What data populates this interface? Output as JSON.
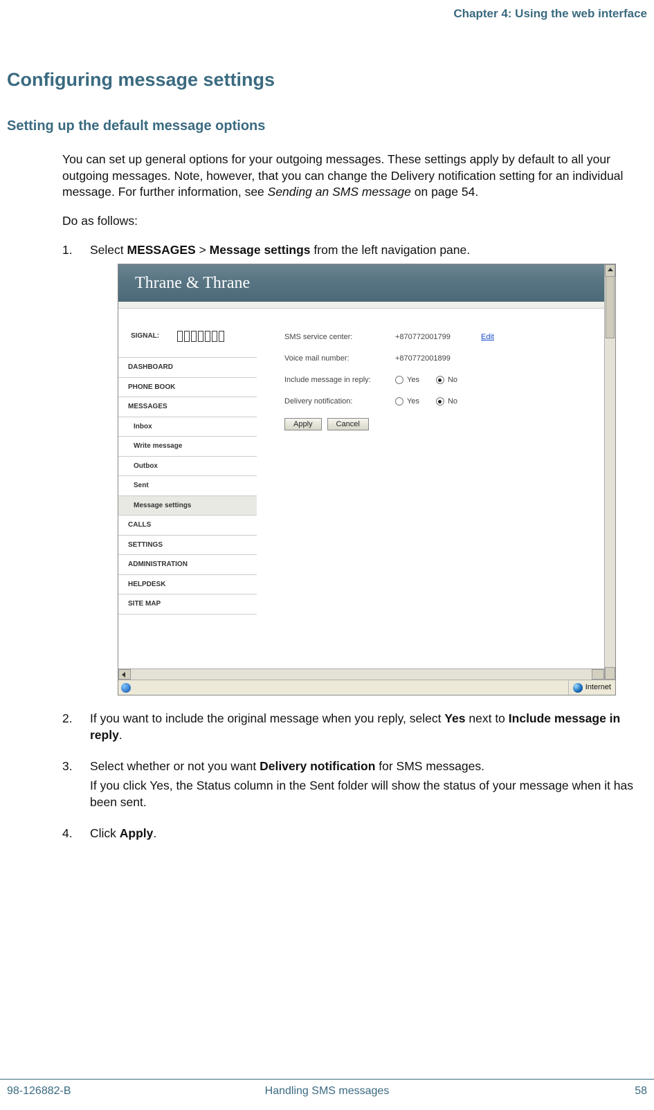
{
  "header": {
    "chapter": "Chapter 4: Using the web interface"
  },
  "h1": "Configuring message settings",
  "h2": "Setting up the default message options",
  "para1_a": "You can set up general options for your outgoing messages. These settings apply by default to all your outgoing messages. Note, however, that you can change the Delivery notification setting for an individual message. For further information, see ",
  "para1_ref": "Sending an SMS message",
  "para1_b": " on page 54.",
  "para2": "Do as follows:",
  "steps": {
    "s1_a": "Select ",
    "s1_b1": "MESSAGES",
    "s1_mid": " > ",
    "s1_b2": "Message settings",
    "s1_c": " from the left navigation pane.",
    "s2_a": "If you want to include the original message when you reply, select ",
    "s2_b1": "Yes",
    "s2_mid": " next to ",
    "s2_b2": "Include message in reply",
    "s2_c": ".",
    "s3_a": "Select whether or not you want ",
    "s3_b1": "Delivery notification",
    "s3_c": " for SMS messages.",
    "s3_sub": "If you click Yes, the Status column in the Sent folder will show the status of your message when it has been sent.",
    "s4_a": "Click ",
    "s4_b1": "Apply",
    "s4_c": "."
  },
  "shot": {
    "banner": "Thrane & Thrane",
    "signal_label": "SIGNAL:",
    "nav": {
      "dashboard": "DASHBOARD",
      "phonebook": "PHONE BOOK",
      "messages": "MESSAGES",
      "inbox": "Inbox",
      "write": "Write message",
      "outbox": "Outbox",
      "sent": "Sent",
      "msgsettings": "Message settings",
      "calls": "CALLS",
      "settings": "SETTINGS",
      "admin": "ADMINISTRATION",
      "helpdesk": "HELPDESK",
      "sitemap": "SITE MAP"
    },
    "form": {
      "smsc_label": "SMS service center:",
      "smsc_value": "+870772001799",
      "edit": "Edit",
      "vm_label": "Voice mail number:",
      "vm_value": "+870772001899",
      "inc_label": "Include message in reply:",
      "del_label": "Delivery notification:",
      "yes": "Yes",
      "no": "No",
      "apply": "Apply",
      "cancel": "Cancel"
    },
    "status_internet": "Internet"
  },
  "footer": {
    "doc_id": "98-126882-B",
    "center": "Handling SMS messages",
    "page_no": "58"
  }
}
